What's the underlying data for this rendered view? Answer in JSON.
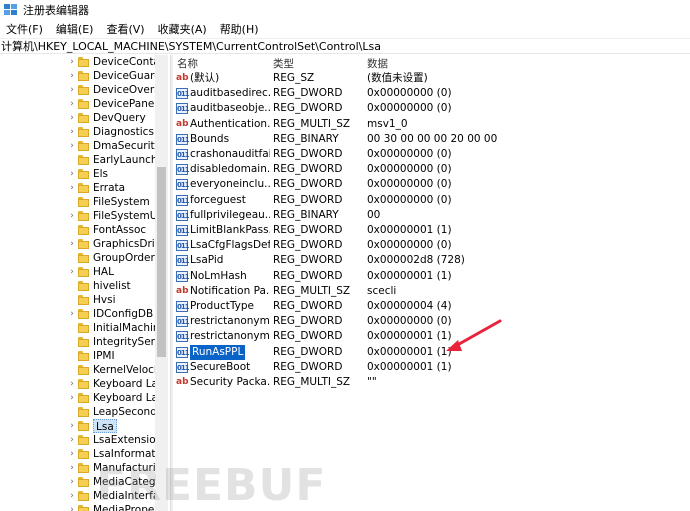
{
  "window": {
    "title": "注册表编辑器"
  },
  "menu": [
    "文件(F)",
    "编辑(E)",
    "查看(V)",
    "收藏夹(A)",
    "帮助(H)"
  ],
  "address": "计算机\\HKEY_LOCAL_MACHINE\\SYSTEM\\CurrentControlSet\\Control\\Lsa",
  "tree": {
    "items": [
      {
        "label": "DeviceContai",
        "expandable": true
      },
      {
        "label": "DeviceGuard",
        "expandable": true
      },
      {
        "label": "DeviceOverric",
        "expandable": true
      },
      {
        "label": "DevicePanels",
        "expandable": true
      },
      {
        "label": "DevQuery",
        "expandable": true
      },
      {
        "label": "Diagnostics",
        "expandable": true
      },
      {
        "label": "DmaSecurity",
        "expandable": true
      },
      {
        "label": "EarlyLaunch",
        "expandable": false
      },
      {
        "label": "Els",
        "expandable": true
      },
      {
        "label": "Errata",
        "expandable": true
      },
      {
        "label": "FileSystem",
        "expandable": false
      },
      {
        "label": "FileSystemUti",
        "expandable": true
      },
      {
        "label": "FontAssoc",
        "expandable": false
      },
      {
        "label": "GraphicsDrive",
        "expandable": true
      },
      {
        "label": "GroupOrderLi",
        "expandable": false
      },
      {
        "label": "HAL",
        "expandable": true
      },
      {
        "label": "hivelist",
        "expandable": false
      },
      {
        "label": "Hvsi",
        "expandable": false
      },
      {
        "label": "IDConfigDB",
        "expandable": true
      },
      {
        "label": "InitialMachine",
        "expandable": false
      },
      {
        "label": "IntegrityServi",
        "expandable": false
      },
      {
        "label": "IPMI",
        "expandable": false
      },
      {
        "label": "KernelVelocit",
        "expandable": false
      },
      {
        "label": "Keyboard Lay",
        "expandable": true
      },
      {
        "label": "Keyboard Lay",
        "expandable": true
      },
      {
        "label": "LeapSecondIr",
        "expandable": false
      },
      {
        "label": "Lsa",
        "expandable": true,
        "selected": true
      },
      {
        "label": "LsaExtensionC",
        "expandable": true
      },
      {
        "label": "LsaInformatio",
        "expandable": true
      },
      {
        "label": "Manufacturin",
        "expandable": true
      },
      {
        "label": "MediaCatego",
        "expandable": true
      },
      {
        "label": "MediaInterfac",
        "expandable": true
      },
      {
        "label": "MediaPropert",
        "expandable": true
      }
    ]
  },
  "list": {
    "columns": {
      "name": "名称",
      "type": "类型",
      "data": "数据"
    },
    "rows": [
      {
        "icon": "ab",
        "name": "(默认)",
        "type": "REG_SZ",
        "data": "(数值未设置)"
      },
      {
        "icon": "bin",
        "name": "auditbasedirec...",
        "type": "REG_DWORD",
        "data": "0x00000000 (0)"
      },
      {
        "icon": "bin",
        "name": "auditbaseobje...",
        "type": "REG_DWORD",
        "data": "0x00000000 (0)"
      },
      {
        "icon": "ab",
        "name": "Authentication...",
        "type": "REG_MULTI_SZ",
        "data": "msv1_0"
      },
      {
        "icon": "bin",
        "name": "Bounds",
        "type": "REG_BINARY",
        "data": "00 30 00 00 00 20 00 00"
      },
      {
        "icon": "bin",
        "name": "crashonauditfail",
        "type": "REG_DWORD",
        "data": "0x00000000 (0)"
      },
      {
        "icon": "bin",
        "name": "disabledomain...",
        "type": "REG_DWORD",
        "data": "0x00000000 (0)"
      },
      {
        "icon": "bin",
        "name": "everyoneinclu...",
        "type": "REG_DWORD",
        "data": "0x00000000 (0)"
      },
      {
        "icon": "bin",
        "name": "forceguest",
        "type": "REG_DWORD",
        "data": "0x00000000 (0)"
      },
      {
        "icon": "bin",
        "name": "fullprivilegeau...",
        "type": "REG_BINARY",
        "data": "00"
      },
      {
        "icon": "bin",
        "name": "LimitBlankPass...",
        "type": "REG_DWORD",
        "data": "0x00000001 (1)"
      },
      {
        "icon": "bin",
        "name": "LsaCfgFlagsDef...",
        "type": "REG_DWORD",
        "data": "0x00000000 (0)"
      },
      {
        "icon": "bin",
        "name": "LsaPid",
        "type": "REG_DWORD",
        "data": "0x000002d8 (728)"
      },
      {
        "icon": "bin",
        "name": "NoLmHash",
        "type": "REG_DWORD",
        "data": "0x00000001 (1)"
      },
      {
        "icon": "ab",
        "name": "Notification Pa...",
        "type": "REG_MULTI_SZ",
        "data": "scecli"
      },
      {
        "icon": "bin",
        "name": "ProductType",
        "type": "REG_DWORD",
        "data": "0x00000004 (4)"
      },
      {
        "icon": "bin",
        "name": "restrictanonym...",
        "type": "REG_DWORD",
        "data": "0x00000000 (0)"
      },
      {
        "icon": "bin",
        "name": "restrictanonym...",
        "type": "REG_DWORD",
        "data": "0x00000001 (1)"
      },
      {
        "icon": "bin",
        "name": "RunAsPPL",
        "type": "REG_DWORD",
        "data": "0x00000001 (1)",
        "selected": true
      },
      {
        "icon": "bin",
        "name": "SecureBoot",
        "type": "REG_DWORD",
        "data": "0x00000001 (1)"
      },
      {
        "icon": "ab",
        "name": "Security Packa...",
        "type": "REG_MULTI_SZ",
        "data": "\"\""
      }
    ]
  },
  "colors": {
    "selection": "#0a64c8",
    "arrow": "#e8233a",
    "folder": "#f6cf52"
  },
  "watermark": "FREEBUF"
}
